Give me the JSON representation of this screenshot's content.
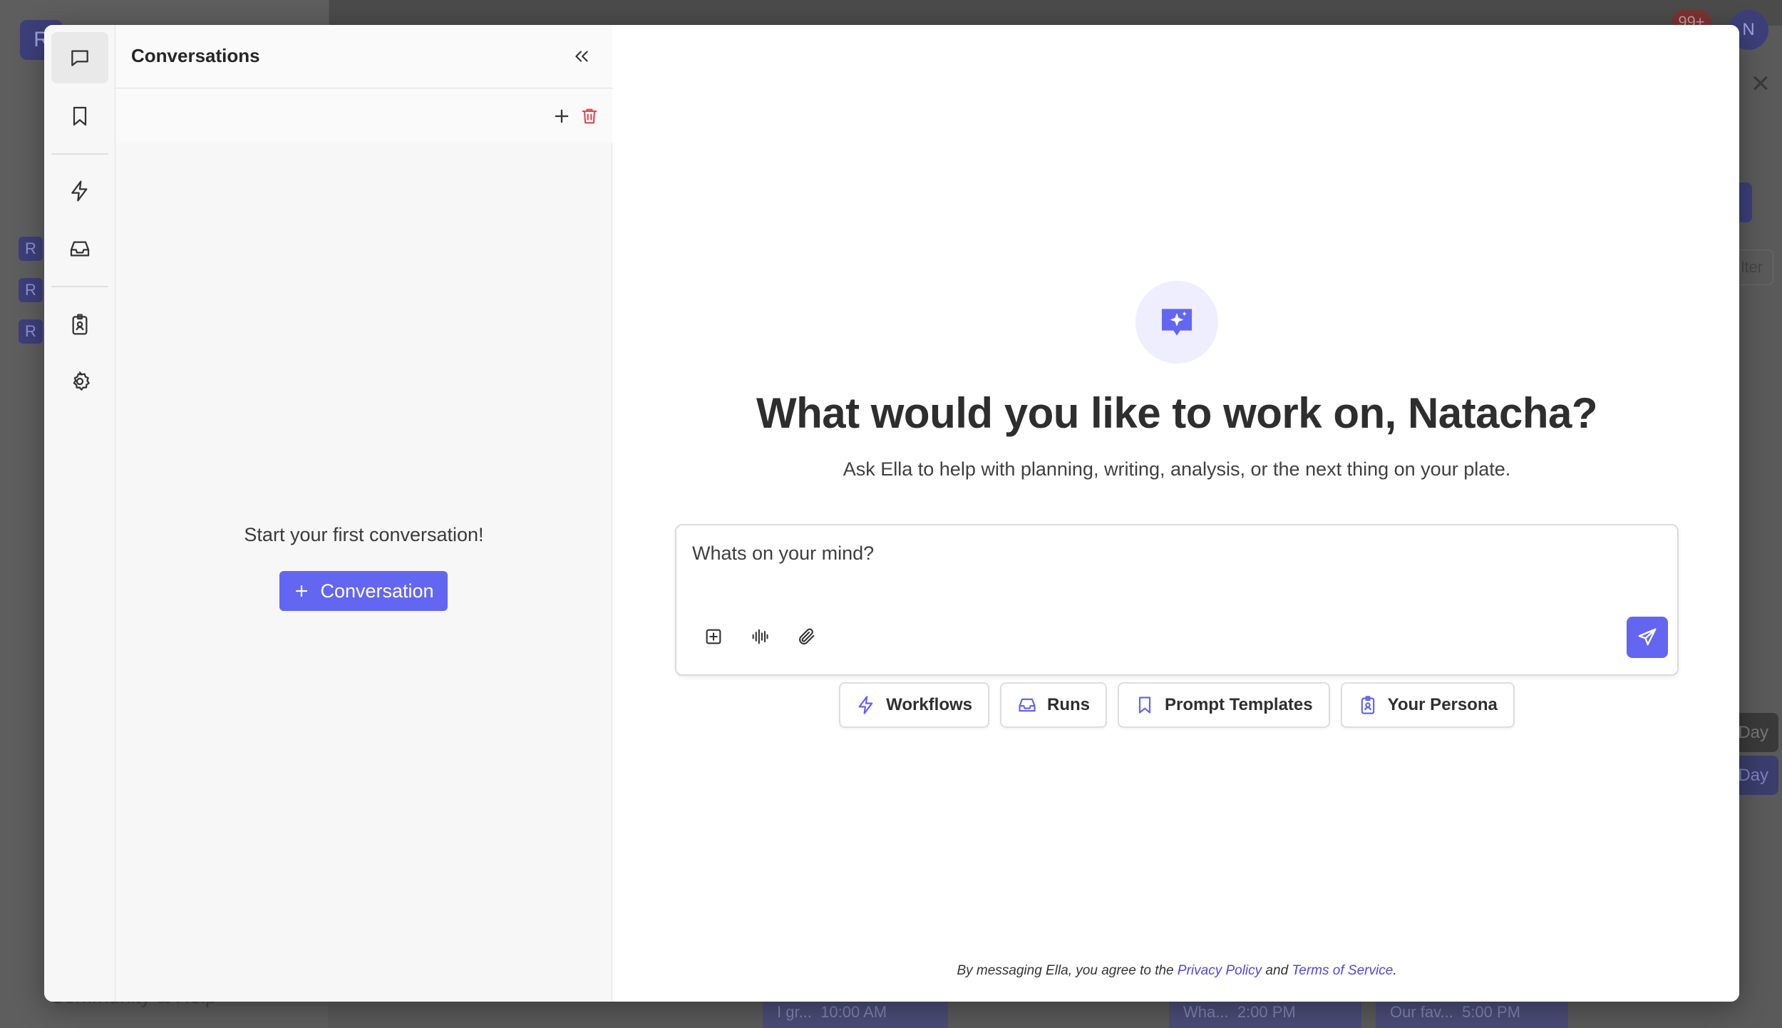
{
  "background": {
    "logo_letter": "R",
    "notification_badge": "99+",
    "avatar_letter": "N",
    "filter_label": "lter",
    "day_tab_1": "Day",
    "day_tab_2": "Day",
    "left_letters": [
      "R",
      "R",
      "R"
    ],
    "bottom_text": "Community & Help",
    "events": [
      {
        "title": "I gr...",
        "time": "10:00 AM"
      },
      {
        "title": "Wha...",
        "time": "2:00 PM"
      },
      {
        "title": "Our fav...",
        "time": "5:00 PM"
      }
    ]
  },
  "rail": {
    "items": [
      {
        "name": "chat-icon",
        "active": true
      },
      {
        "name": "bookmark-icon",
        "active": false
      },
      {
        "name": "lightning-icon",
        "active": false
      },
      {
        "name": "inbox-icon",
        "active": false
      },
      {
        "name": "badge-icon",
        "active": false
      },
      {
        "name": "gear-icon",
        "active": false
      }
    ]
  },
  "conversations": {
    "title": "Conversations",
    "empty_text": "Start your first conversation!",
    "new_button_label": "Conversation"
  },
  "main": {
    "title": "What would you like to work on, Natacha?",
    "subtitle": "Ask Ella to help with planning, writing, analysis, or the next thing on your plate.",
    "composer": {
      "placeholder": "Whats on your mind?",
      "value": ""
    },
    "chips": [
      {
        "label": "Workflows",
        "icon": "lightning-icon"
      },
      {
        "label": "Runs",
        "icon": "inbox-icon"
      },
      {
        "label": "Prompt Templates",
        "icon": "bookmark-icon"
      },
      {
        "label": "Your Persona",
        "icon": "badge-icon"
      }
    ],
    "legal": {
      "prefix": "By messaging Ella, you agree to the ",
      "privacy": "Privacy Policy",
      "and": " and ",
      "terms": "Terms of Service",
      "suffix": "."
    }
  },
  "colors": {
    "accent": "#6366f1",
    "danger": "#e0474c",
    "hero_bg": "#eeeefe"
  }
}
